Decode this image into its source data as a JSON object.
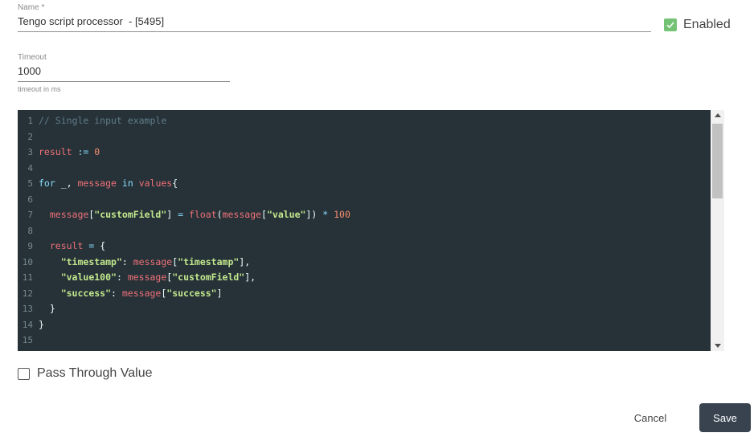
{
  "form": {
    "name": {
      "label": "Name *",
      "value": "Tengo script processor  - [5495]"
    },
    "enabled": {
      "label": "Enabled",
      "checked": true,
      "color": "#5cb85c"
    },
    "timeout": {
      "label": "Timeout",
      "value": "1000",
      "help": "timeout in ms"
    },
    "pass_through": {
      "label": "Pass Through Value",
      "checked": false
    }
  },
  "editor": {
    "background": "#263238",
    "line_numbers": [
      "1",
      "2",
      "3",
      "4",
      "5",
      "6",
      "7",
      "8",
      "9",
      "10",
      "11",
      "12",
      "13",
      "14",
      "15"
    ]
  },
  "code": {
    "l1": {
      "comment": "// Single input example"
    },
    "l3": {
      "var": "result",
      "op": " := ",
      "num": "0"
    },
    "l5": {
      "kw": "for",
      "txt1": " _, ",
      "var": "message",
      "txt2": " ",
      "kw2": "in",
      "txt3": " ",
      "var2": "values",
      "txt4": "{"
    },
    "l7": {
      "indent": "  ",
      "var": "message",
      "br1": "[",
      "str": "\"customField\"",
      "br2": "] ",
      "op": "=",
      "txt1": " ",
      "fn": "float",
      "br3": "(",
      "var2": "message",
      "br4": "[",
      "str2": "\"value\"",
      "br5": "]) ",
      "op2": "*",
      "txt2": " ",
      "num": "100"
    },
    "l9": {
      "indent": "  ",
      "var": "result",
      "txt": " ",
      "op": "=",
      "br": " {"
    },
    "l10": {
      "indent": "    ",
      "str": "\"timestamp\"",
      "txt": ": ",
      "var": "message",
      "br1": "[",
      "str2": "\"timestamp\"",
      "br2": "],"
    },
    "l11": {
      "indent": "    ",
      "str": "\"value100\"",
      "txt": ": ",
      "var": "message",
      "br1": "[",
      "str2": "\"customField\"",
      "br2": "],"
    },
    "l12": {
      "indent": "    ",
      "str": "\"success\"",
      "txt": ": ",
      "var": "message",
      "br1": "[",
      "str2": "\"success\"",
      "br2": "]"
    },
    "l13": {
      "txt": "  }"
    },
    "l14": {
      "txt": "}"
    }
  },
  "actions": {
    "cancel": "Cancel",
    "save": "Save",
    "save_color": "#38434f"
  }
}
